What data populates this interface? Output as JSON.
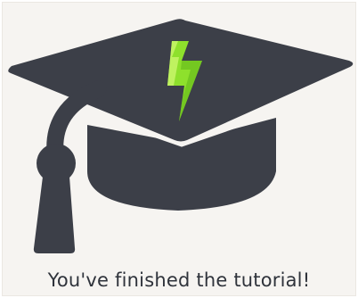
{
  "completion": {
    "message": "You've finished the tutorial!"
  },
  "illustration": {
    "icon": "graduation-cap-icon",
    "emblem_icon": "lightning-bolt-icon"
  },
  "colors": {
    "background": "#f6f4f1",
    "cap": "#3c3f48",
    "accent": "#8ee02c",
    "text": "#2f333b"
  }
}
